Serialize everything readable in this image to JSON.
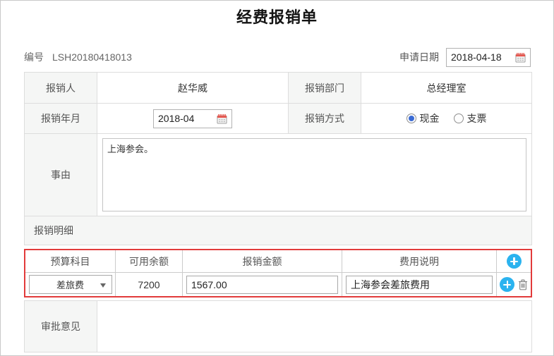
{
  "title": "经费报销单",
  "colors": {
    "highlight": "#e23b3b",
    "add_blue": "#2bb3ef",
    "radio_blue": "#3a6ad4"
  },
  "meta": {
    "number_label": "编号",
    "number_value": "LSH20180418013",
    "apply_date_label": "申请日期",
    "apply_date_value": "2018-04-18"
  },
  "form": {
    "person_label": "报销人",
    "person_value": "赵华威",
    "dept_label": "报销部门",
    "dept_value": "总经理室",
    "month_label": "报销年月",
    "month_value": "2018-04",
    "method_label": "报销方式",
    "method_options": [
      {
        "label": "现金",
        "selected": true
      },
      {
        "label": "支票",
        "selected": false
      }
    ],
    "reason_label": "事由",
    "reason_value": "上海参会。",
    "detail_section_label": "报销明细",
    "approval_label": "审批意见",
    "approval_value": ""
  },
  "detail_table": {
    "headers": [
      "预算科目",
      "可用余额",
      "报销金额",
      "费用说明"
    ],
    "rows": [
      {
        "subject": "差旅费",
        "available": "7200",
        "amount": "1567.00",
        "description": "上海参会差旅费用"
      }
    ]
  }
}
